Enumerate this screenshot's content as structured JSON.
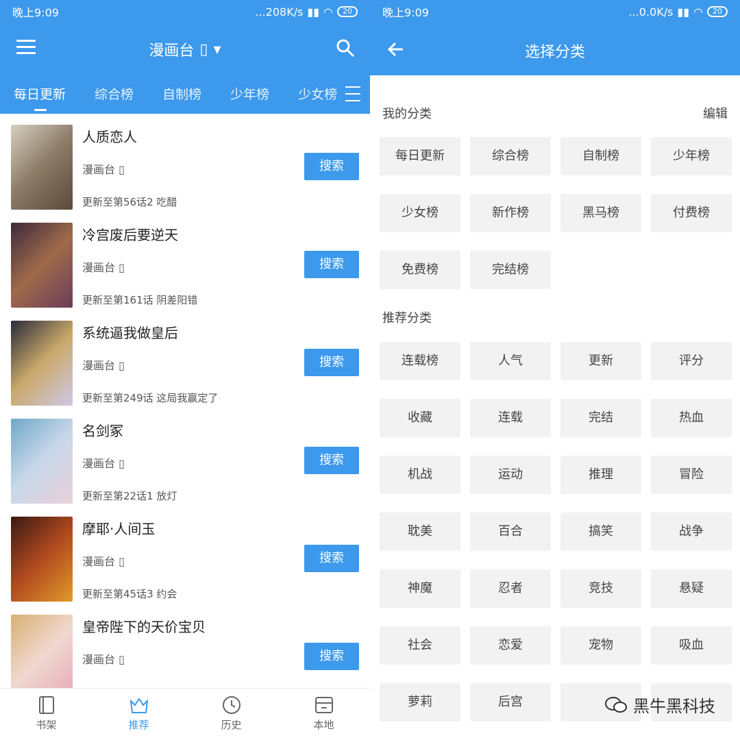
{
  "left": {
    "status": {
      "time": "晚上9:09",
      "speed": "...208K/s",
      "battery": "20"
    },
    "appbar": {
      "title": "漫画台"
    },
    "tabs": [
      "每日更新",
      "综合榜",
      "自制榜",
      "少年榜",
      "少女榜"
    ],
    "items": [
      {
        "name": "人质恋人",
        "source": "漫画台",
        "update": "更新至第56话2 吃醋",
        "button": "搜索"
      },
      {
        "name": "冷宫废后要逆天",
        "source": "漫画台",
        "update": "更新至第161话 阴差阳错",
        "button": "搜索"
      },
      {
        "name": "系统逼我做皇后",
        "source": "漫画台",
        "update": "更新至第249话 这局我赢定了",
        "button": "搜索"
      },
      {
        "name": "名剑冢",
        "source": "漫画台",
        "update": "更新至第22话1 放灯",
        "button": "搜索"
      },
      {
        "name": "摩耶·人间玉",
        "source": "漫画台",
        "update": "更新至第45话3 约会",
        "button": "搜索"
      },
      {
        "name": "皇帝陛下的天价宝贝",
        "source": "漫画台",
        "update": "",
        "button": "搜索"
      }
    ],
    "bottom_nav": [
      "书架",
      "推荐",
      "历史",
      "本地"
    ]
  },
  "right": {
    "status": {
      "time": "晚上9:09",
      "speed": "...0.0K/s",
      "battery": "20"
    },
    "appbar": {
      "title": "选择分类"
    },
    "my_categories_title": "我的分类",
    "edit_label": "编辑",
    "my_categories": [
      "每日更新",
      "综合榜",
      "自制榜",
      "少年榜",
      "少女榜",
      "新作榜",
      "黑马榜",
      "付费榜",
      "免费榜",
      "完结榜"
    ],
    "recommended_title": "推荐分类",
    "recommended": [
      "连载榜",
      "人气",
      "更新",
      "评分",
      "收藏",
      "连载",
      "完结",
      "热血",
      "机战",
      "运动",
      "推理",
      "冒险",
      "耽美",
      "百合",
      "搞笑",
      "战争",
      "神魔",
      "忍者",
      "竞技",
      "悬疑",
      "社会",
      "恋爱",
      "宠物",
      "吸血",
      "萝莉",
      "后宫",
      "",
      ""
    ],
    "watermark": "黑牛黑科技"
  }
}
